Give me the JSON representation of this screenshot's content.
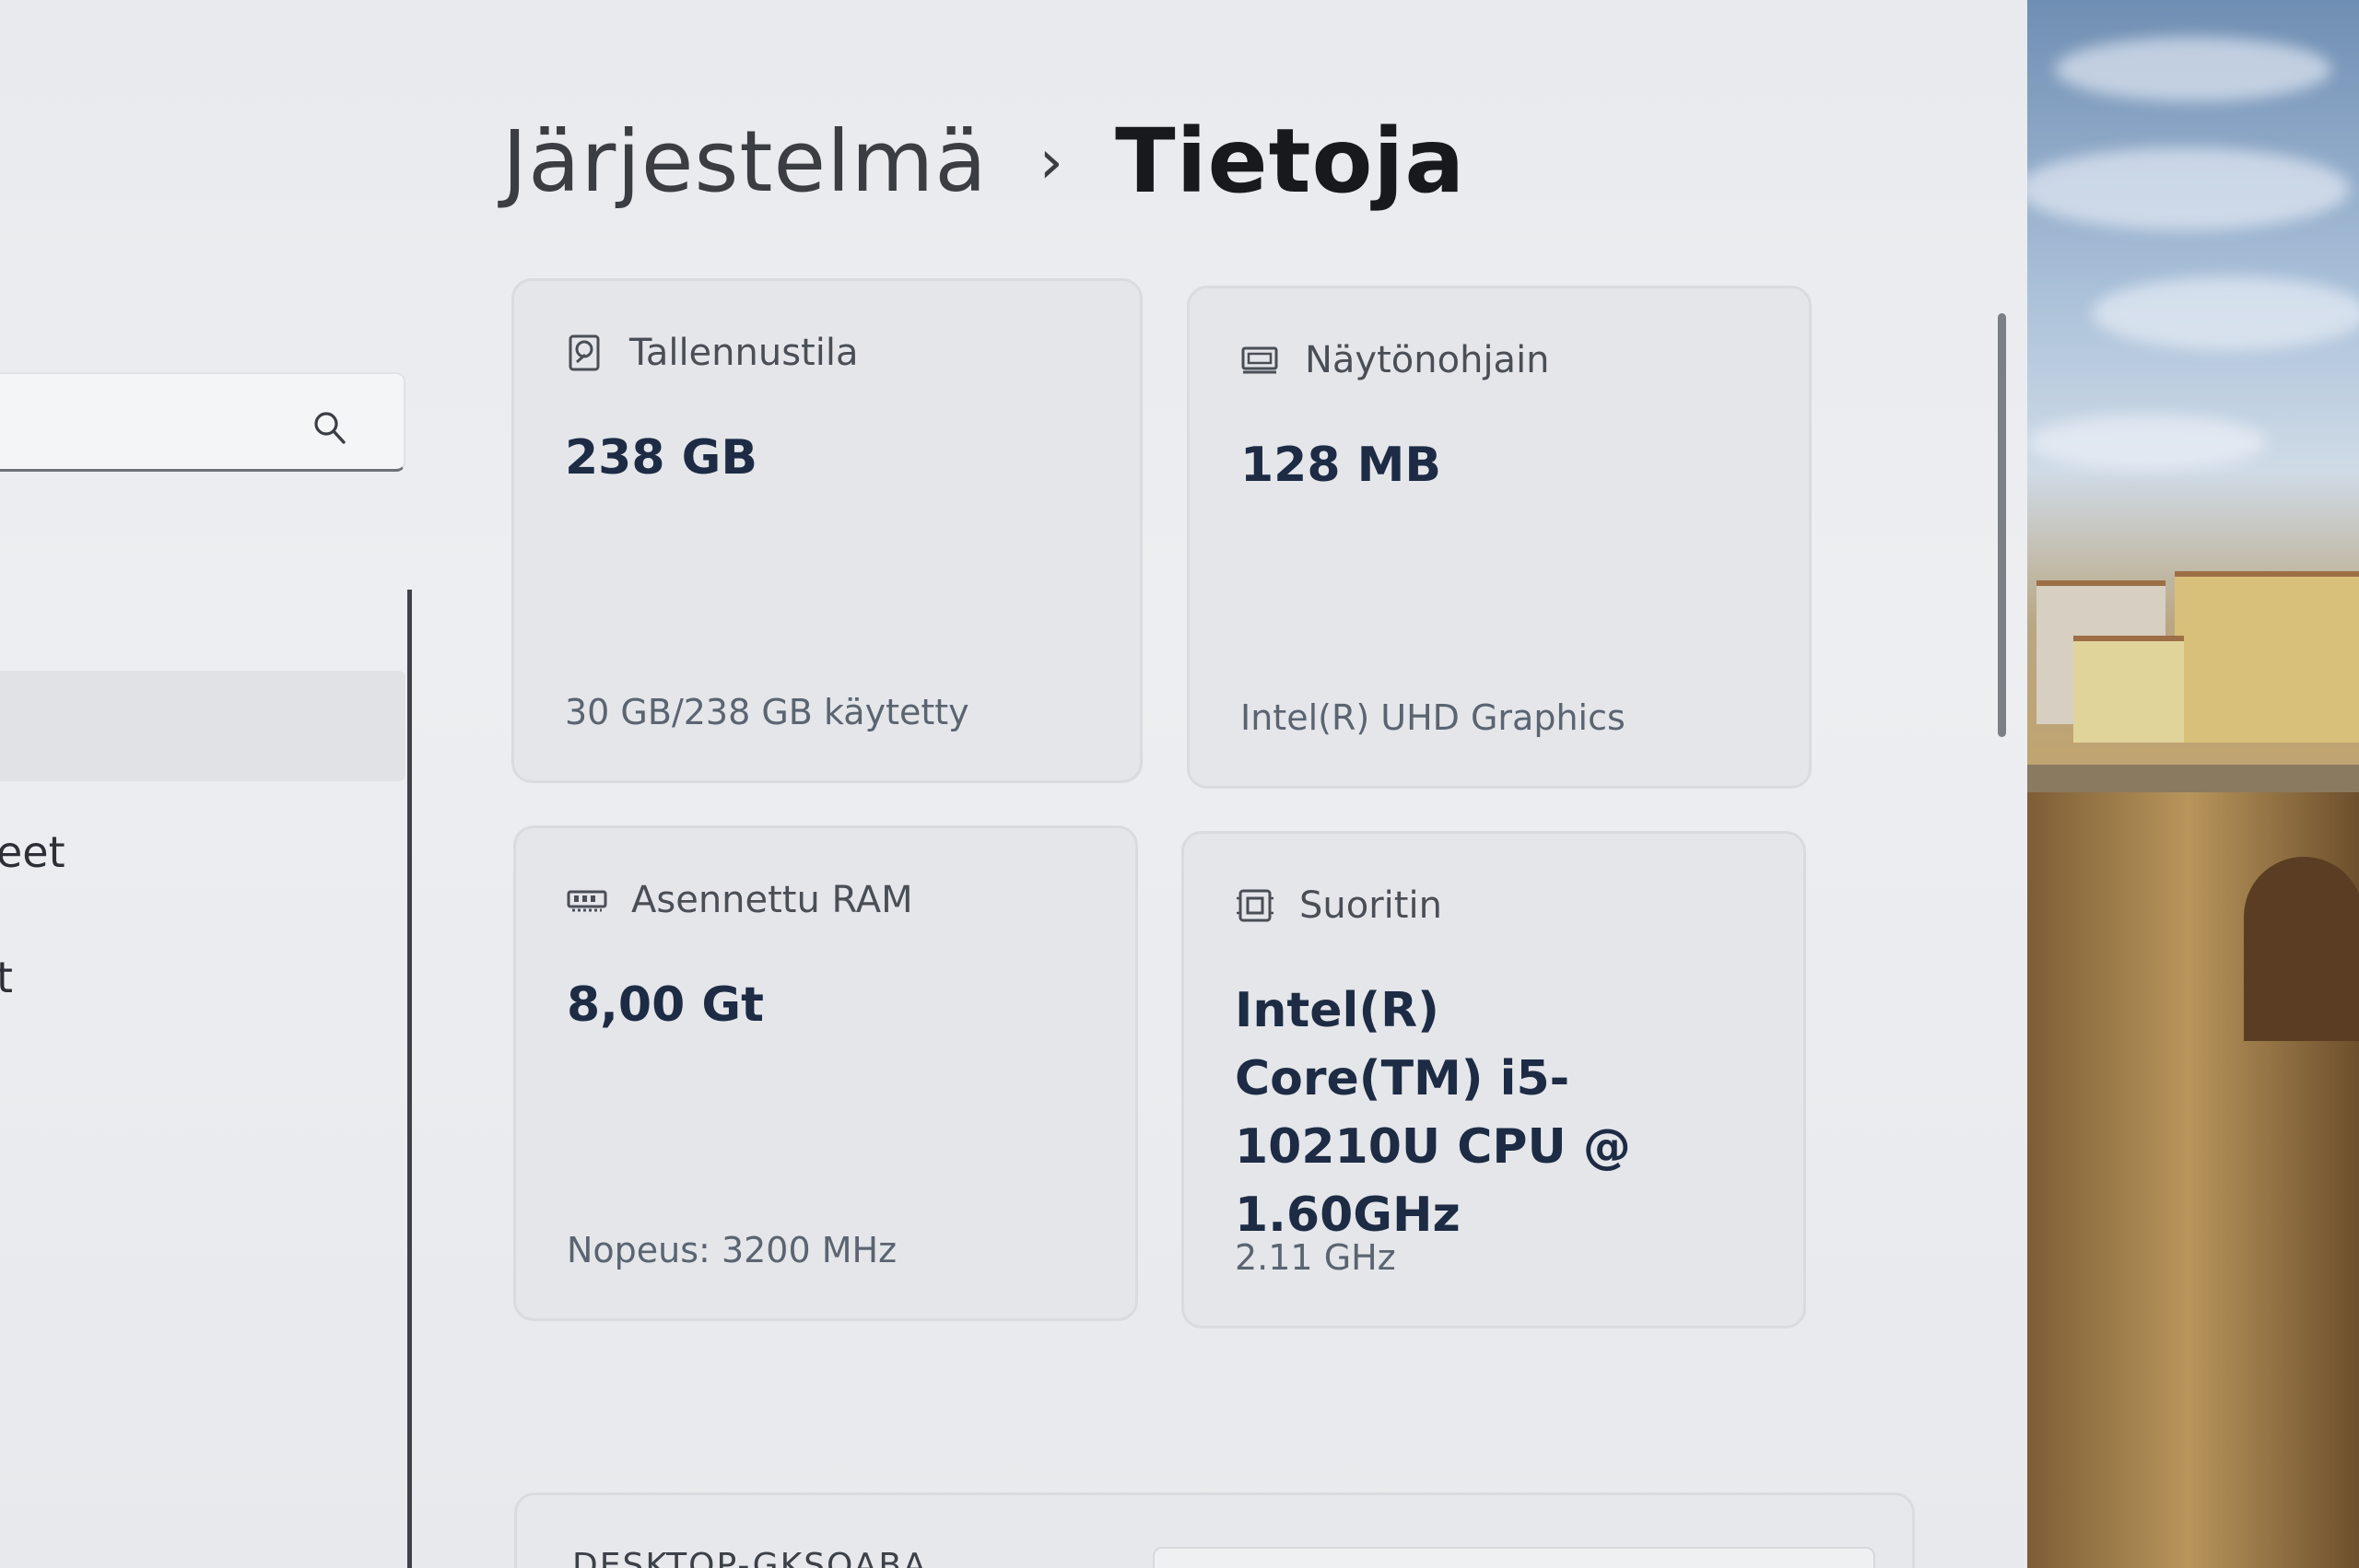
{
  "breadcrumb": {
    "parent": "Järjestelmä",
    "separator": "›",
    "current": "Tietoja"
  },
  "search": {
    "icon": "search-icon"
  },
  "nav": {
    "items": [
      {
        "label": "eet"
      },
      {
        "label": "t"
      }
    ]
  },
  "specs": {
    "storage": {
      "icon": "hard-drive-icon",
      "label": "Tallennustila",
      "value": "238 GB",
      "detail": "30 GB/238 GB käytetty"
    },
    "graphics": {
      "icon": "display-adapter-icon",
      "label": "Näytönohjain",
      "value": "128 MB",
      "detail": "Intel(R) UHD Graphics"
    },
    "ram": {
      "icon": "memory-icon",
      "label": "Asennettu RAM",
      "value": "8,00 Gt",
      "detail": "Nopeus: 3200 MHz"
    },
    "processor": {
      "icon": "processor-icon",
      "label": "Suoritin",
      "value": "Intel(R) Core(TM) i5-10210U CPU @ 1.60GHz",
      "detail": "2.11 GHz"
    }
  },
  "device": {
    "name": "DESKTOP-GKSOABA"
  }
}
